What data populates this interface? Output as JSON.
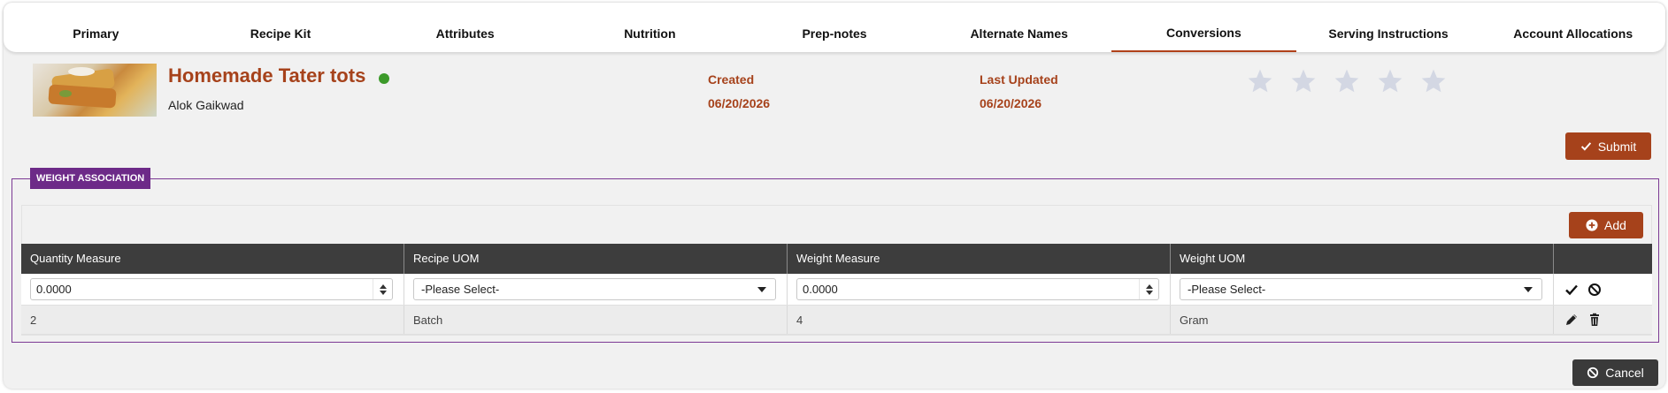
{
  "tabs": [
    {
      "label": "Primary"
    },
    {
      "label": "Recipe Kit"
    },
    {
      "label": "Attributes"
    },
    {
      "label": "Nutrition"
    },
    {
      "label": "Prep-notes"
    },
    {
      "label": "Alternate Names"
    },
    {
      "label": "Conversions",
      "active": true
    },
    {
      "label": "Serving Instructions"
    },
    {
      "label": "Account Allocations"
    }
  ],
  "recipe": {
    "title": "Homemade Tater tots",
    "author": "Alok Gaikwad",
    "status_color": "#3c9a2a",
    "created_label": "Created",
    "created_value": "06/20/2026",
    "updated_label": "Last Updated",
    "updated_value": "06/20/2026",
    "rating": 0,
    "rating_max": 5
  },
  "actions": {
    "submit_label": "Submit",
    "add_label": "Add",
    "cancel_label": "Cancel"
  },
  "weight_association": {
    "section_label": "WEIGHT ASSOCIATION",
    "columns": [
      "Quantity Measure",
      "Recipe UOM",
      "Weight Measure",
      "Weight UOM"
    ],
    "edit_row": {
      "quantity_measure": "0.0000",
      "recipe_uom": "-Please Select-",
      "weight_measure": "0.0000",
      "weight_uom": "-Please Select-"
    },
    "rows": [
      {
        "quantity_measure": "2",
        "recipe_uom": "Batch",
        "weight_measure": "4",
        "weight_uom": "Gram"
      }
    ]
  },
  "colors": {
    "accent": "#a6421b",
    "section": "#6d2a88",
    "header_bg": "#3d3d3d",
    "star": "#d3d7e3"
  }
}
